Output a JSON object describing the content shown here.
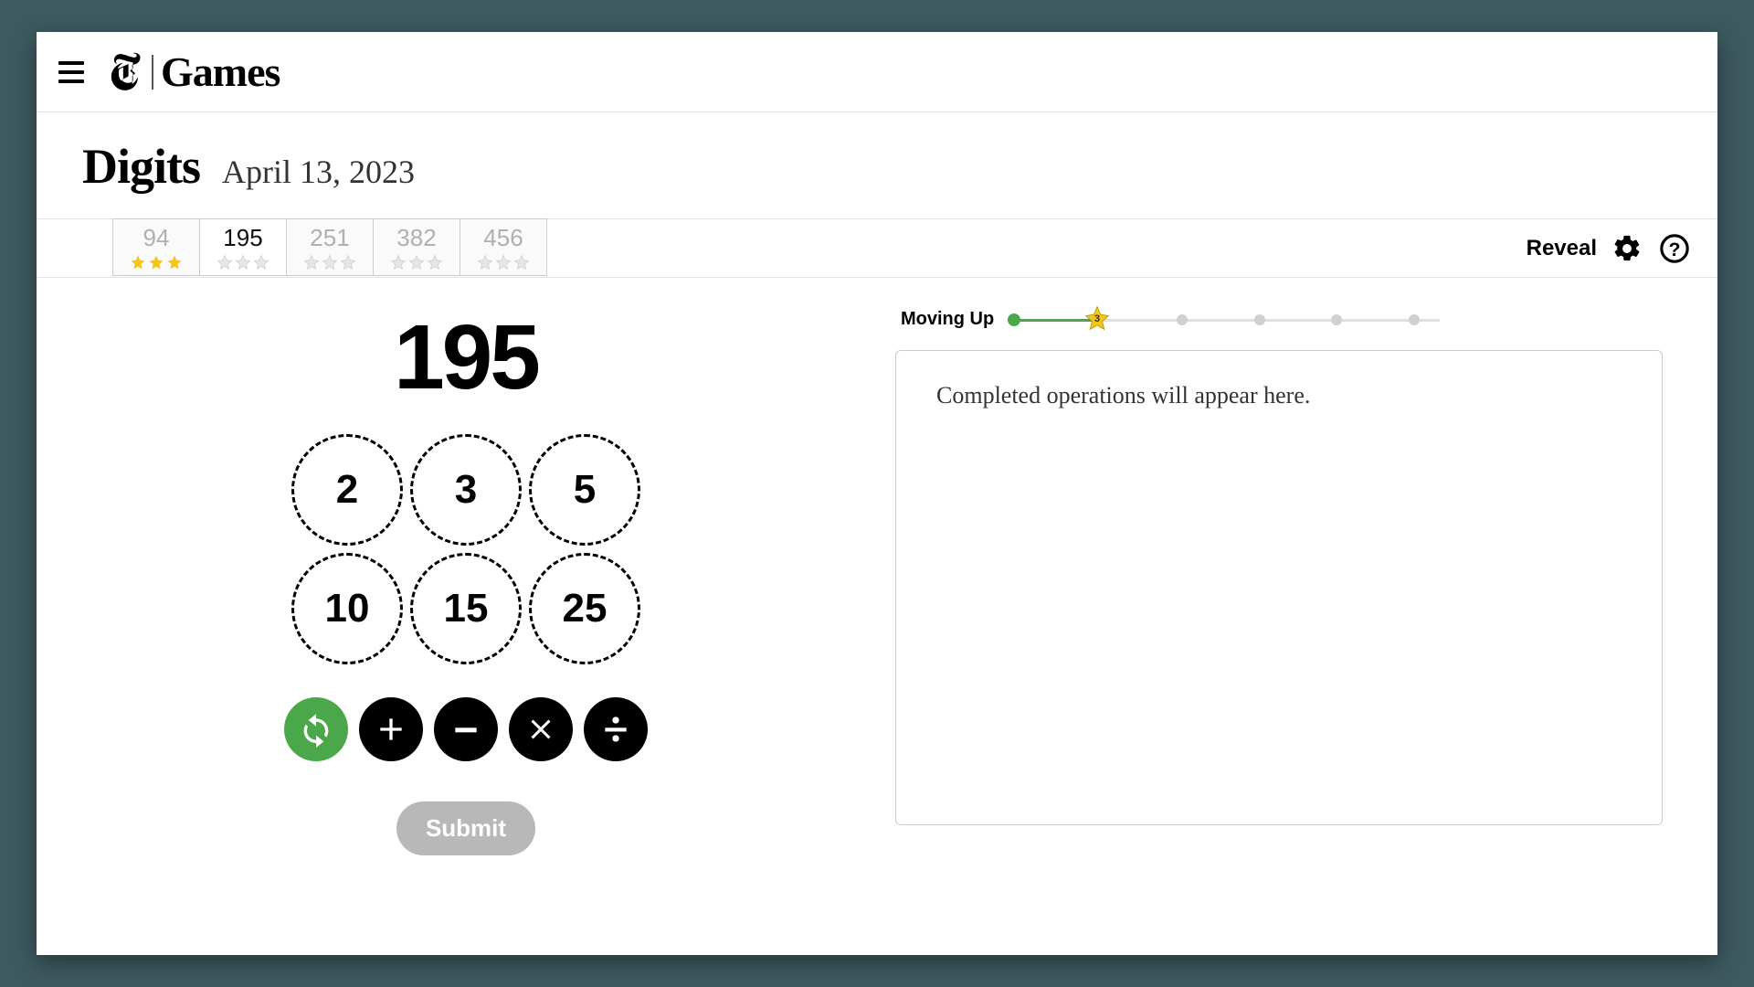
{
  "header": {
    "brand_letter": "T",
    "brand_word": "Games"
  },
  "title": {
    "game_name": "Digits",
    "date": "April 13, 2023"
  },
  "tabs": [
    {
      "target": "94",
      "stars_earned": 3,
      "active": false
    },
    {
      "target": "195",
      "stars_earned": 0,
      "active": true
    },
    {
      "target": "251",
      "stars_earned": 0,
      "active": false
    },
    {
      "target": "382",
      "stars_earned": 0,
      "active": false
    },
    {
      "target": "456",
      "stars_earned": 0,
      "active": false
    }
  ],
  "actions": {
    "reveal_label": "Reveal"
  },
  "game": {
    "target": "195",
    "numbers": [
      "2",
      "3",
      "5",
      "10",
      "15",
      "25"
    ],
    "submit_label": "Submit"
  },
  "progress": {
    "label": "Moving Up",
    "star_value": "3",
    "fill_percent": "20",
    "dots_percent": [
      "0",
      "40",
      "58",
      "76",
      "94"
    ]
  },
  "log": {
    "placeholder": "Completed operations will appear here."
  },
  "colors": {
    "accent_green": "#4aa84a",
    "star_gold": "#f5c518"
  }
}
